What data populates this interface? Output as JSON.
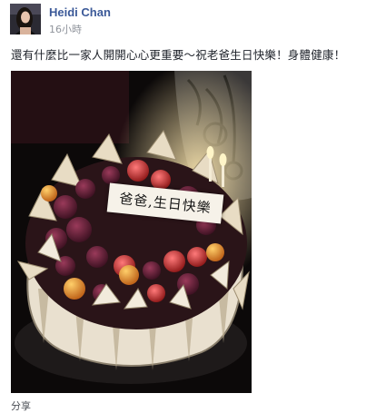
{
  "post": {
    "author": "Heidi Chan",
    "timestamp": "16小時",
    "message": "還有什麼比一家人開開心心更重要～祝老爸生日快樂！身體健康！",
    "photo": {
      "cake_label": "爸爸,生日快樂"
    },
    "actions": {
      "share_label": "分享"
    }
  }
}
